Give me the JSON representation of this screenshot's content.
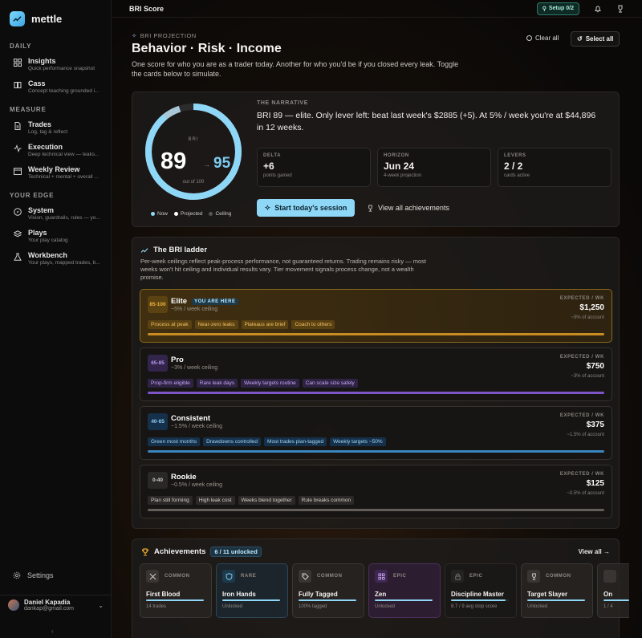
{
  "app": {
    "name": "mettle"
  },
  "sidebar": {
    "sections": [
      {
        "label": "DAILY"
      },
      {
        "label": "MEASURE"
      },
      {
        "label": "YOUR EDGE"
      }
    ],
    "items": [
      {
        "label": "Insights",
        "sub": "Quick performance snapshot",
        "icon": "grid-icon"
      },
      {
        "label": "Cass",
        "sub": "Concept teaching grounded i...",
        "icon": "book-icon"
      },
      {
        "label": "Trades",
        "sub": "Log, tag & reflect",
        "icon": "document-icon"
      },
      {
        "label": "Execution",
        "sub": "Deep technical view — leaks...",
        "icon": "activity-icon"
      },
      {
        "label": "Weekly Review",
        "sub": "Technical + mental + overall ...",
        "icon": "calendar-icon"
      },
      {
        "label": "System",
        "sub": "Vision, guardrails, rules — yo...",
        "icon": "compass-icon"
      },
      {
        "label": "Plays",
        "sub": "Your play catalog",
        "icon": "layers-icon"
      },
      {
        "label": "Workbench",
        "sub": "Your plays, mapped trades, b...",
        "icon": "flask-icon"
      }
    ],
    "settings": "Settings",
    "user": {
      "name": "Daniel Kapadia",
      "email": "dankap@gmail.com"
    }
  },
  "topbar": {
    "title": "BRI Score",
    "setup": "Setup 0/2"
  },
  "hero": {
    "kicker": "BRI PROJECTION",
    "title": "Behavior · Risk · Income",
    "desc": "One score for who you are as a trader today. Another for who you'd be if you closed every leak. Toggle the cards below to simulate.",
    "clear": "Clear all",
    "select": "Select all"
  },
  "score": {
    "label": "BRI",
    "now": "89",
    "projected": "95",
    "arrow": "→",
    "out_of": "out of 100",
    "now_fraction": 0.89,
    "projected_fraction": 0.95,
    "legend": [
      "Now",
      "Projected",
      "Ceiling"
    ],
    "narrative_kicker": "THE NARRATIVE",
    "narrative": "BRI 89 — elite. Only lever left: beat last week's $2885 (+5). At 5% / week you're at $44,896 in 12 weeks.",
    "stats": [
      {
        "k": "DELTA",
        "v": "+6",
        "s": "points gained"
      },
      {
        "k": "HORIZON",
        "v": "Jun 24",
        "s": "4-week projection"
      },
      {
        "k": "LEVERS",
        "v": "2 / 2",
        "s": "cards active"
      }
    ],
    "start": "Start today's session",
    "achievements_link": "View all achievements"
  },
  "ladder": {
    "title": "The BRI ladder",
    "desc": "Per-week ceilings reflect peak-process performance, not guaranteed returns. Trading remains risky — most weeks won't hit ceiling and individual results vary. Tier movement signals process change, not a wealth promise.",
    "tiers": [
      {
        "range": "85-100",
        "name": "Elite",
        "ceiling": "~5% / week ceiling",
        "badge": "YOU ARE HERE",
        "exp_label": "EXPECTED / WK",
        "exp": "$1,250",
        "exp_sub": "~5% of account",
        "tags": [
          "Process at peak",
          "Near-zero leaks",
          "Plateaus are brief",
          "Coach to others"
        ],
        "color": "#e0a22a"
      },
      {
        "range": "65-85",
        "name": "Pro",
        "ceiling": "~3% / week ceiling",
        "exp_label": "EXPECTED / WK",
        "exp": "$750",
        "exp_sub": "~3% of account",
        "tags": [
          "Prop-firm eligible",
          "Rare leak days",
          "Weekly targets routine",
          "Can scale size safely"
        ],
        "color": "#8b5fd6"
      },
      {
        "range": "40-65",
        "name": "Consistent",
        "ceiling": "~1.5% / week ceiling",
        "exp_label": "EXPECTED / WK",
        "exp": "$375",
        "exp_sub": "~1.5% of account",
        "tags": [
          "Green most months",
          "Drawdowns controlled",
          "Most trades plan-tagged",
          "Weekly targets ~50%"
        ],
        "color": "#3f8fc8"
      },
      {
        "range": "0-40",
        "name": "Rookie",
        "ceiling": "~0.5% / week ceiling",
        "exp_label": "EXPECTED / WK",
        "exp": "$125",
        "exp_sub": "~0.5% of account",
        "tags": [
          "Plan still forming",
          "High leak cost",
          "Weeks blend together",
          "Rule breaks common"
        ],
        "color": "#6a6663"
      }
    ]
  },
  "achievements": {
    "title": "Achievements",
    "count": "6 / 11 unlocked",
    "view_all": "View all →",
    "items": [
      {
        "rarity": "COMMON",
        "name": "First Blood",
        "sub": "14 trades",
        "icon": "swords-icon",
        "progress": 1.0,
        "color": "#8fd7f6"
      },
      {
        "rarity": "RARE",
        "name": "Iron Hands",
        "sub": "Unlocked",
        "icon": "shield-icon",
        "progress": 1.0,
        "color": "#8fd7f6"
      },
      {
        "rarity": "COMMON",
        "name": "Fully Tagged",
        "sub": "100% tagged",
        "icon": "tag-icon",
        "progress": 1.0,
        "color": "#8fd7f6"
      },
      {
        "rarity": "EPIC",
        "name": "Zen",
        "sub": "Unlocked",
        "icon": "grid-icon",
        "progress": 1.0,
        "color": "#8fd7f6"
      },
      {
        "rarity": "EPIC",
        "name": "Discipline Master",
        "sub": "8.7 / 9 avg stop score",
        "icon": "lock-icon",
        "progress": 0.95,
        "color": "#8fd7f6"
      },
      {
        "rarity": "COMMON",
        "name": "Target Slayer",
        "sub": "Unlocked",
        "icon": "trophy-icon",
        "progress": 1.0,
        "color": "#8fd7f6"
      },
      {
        "rarity": "",
        "name": "On",
        "sub": "1 / 4",
        "icon": "",
        "progress": 0.3,
        "color": "#8fd7f6"
      }
    ]
  }
}
